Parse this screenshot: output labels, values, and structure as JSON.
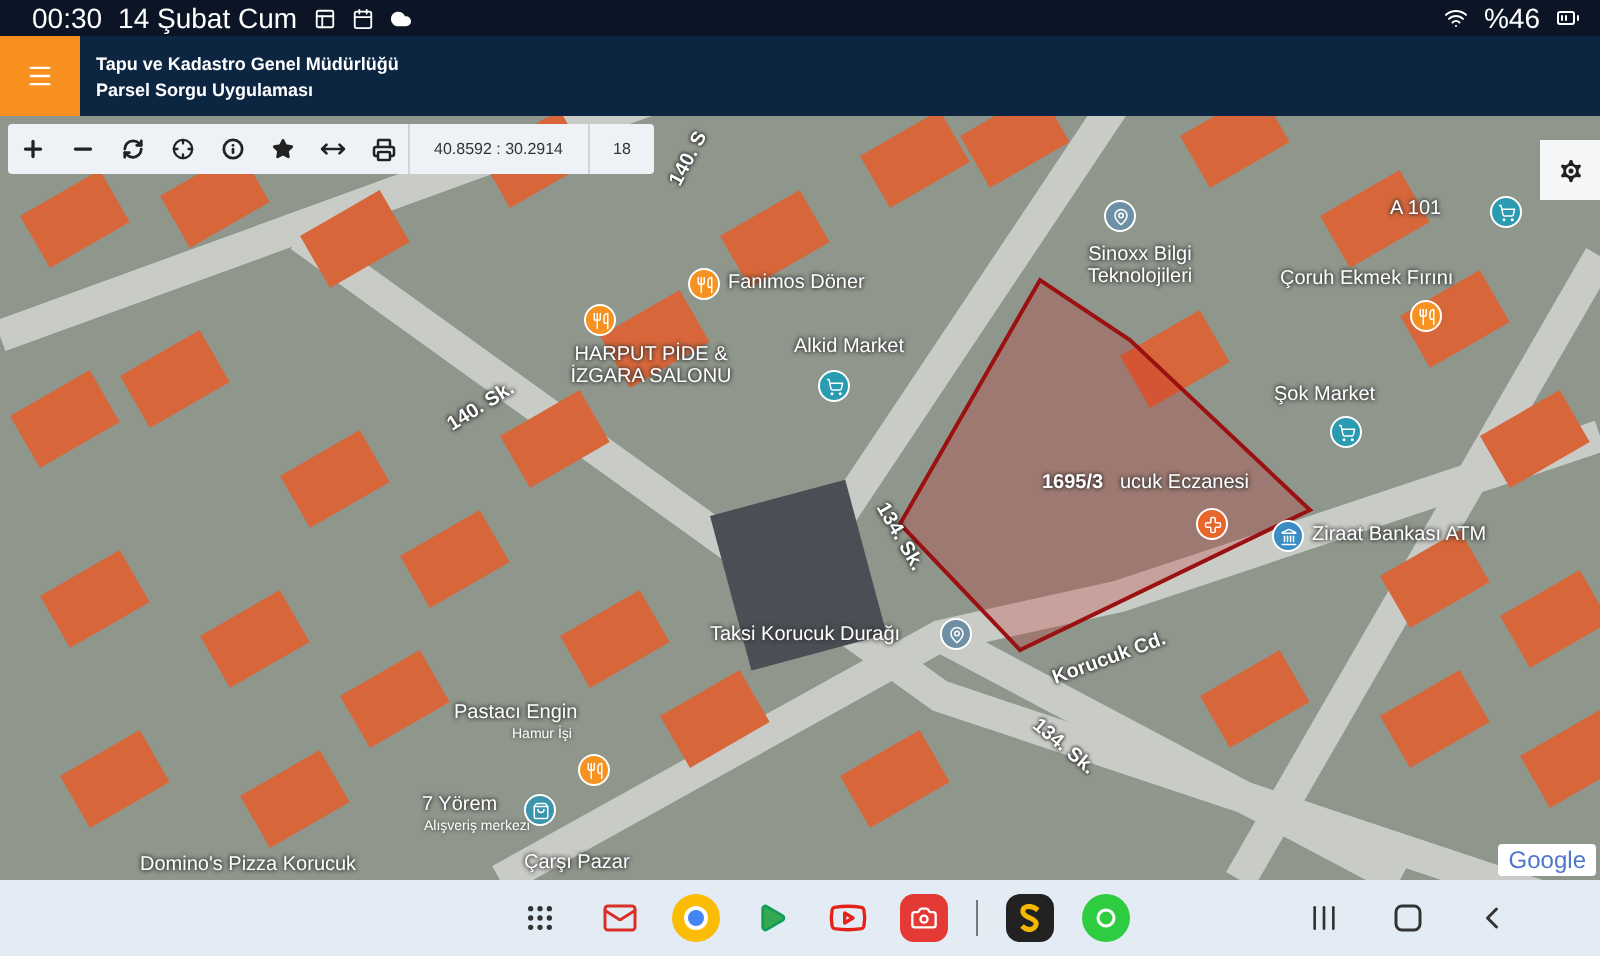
{
  "status_bar": {
    "time": "00:30",
    "date": "14 Şubat Cum",
    "battery": "%46"
  },
  "header": {
    "title": "Tapu ve Kadastro Genel Müdürlüğü",
    "subtitle": "Parsel Sorgu Uygulaması"
  },
  "toolbar": {
    "coordinates": "40.8592 : 30.2914",
    "zoom": "18"
  },
  "map": {
    "parcel": {
      "label": "1695/3"
    },
    "places": [
      {
        "kind": "food",
        "label": "Fanimos Döner"
      },
      {
        "kind": "food",
        "label": "HARPUT PİDE & İZGARA SALONU"
      },
      {
        "kind": "shop",
        "label": "Alkid Market"
      },
      {
        "kind": "place",
        "label": "Sinoxx Bilgi Teknolojileri"
      },
      {
        "kind": "shop",
        "label": "A 101"
      },
      {
        "kind": "food",
        "label": "Çoruh Ekmek Fırını"
      },
      {
        "kind": "shop",
        "label": "Şok Market"
      },
      {
        "kind": "pharmacy",
        "label": "ucuk Eczanesi"
      },
      {
        "kind": "bank",
        "label": "Ziraat Bankası ATM"
      },
      {
        "kind": "place",
        "label": "Taksi Korucuk Durağı"
      },
      {
        "kind": "food",
        "label": "Pastacı Engin",
        "sublabel": "Hamur İşi"
      },
      {
        "kind": "mall",
        "label": "7 Yörem",
        "sublabel": "Alışveriş merkezi"
      },
      {
        "kind": "none",
        "label": "Domino's Pizza Korucuk"
      },
      {
        "kind": "none",
        "label": "Çarşı Pazar"
      }
    ],
    "streets": [
      {
        "label": "140. S"
      },
      {
        "label": "140. Sk."
      },
      {
        "label": "134. Sk."
      },
      {
        "label": "Korucuk Cd."
      },
      {
        "label": "134. Sk."
      }
    ],
    "attribution": "Google"
  }
}
